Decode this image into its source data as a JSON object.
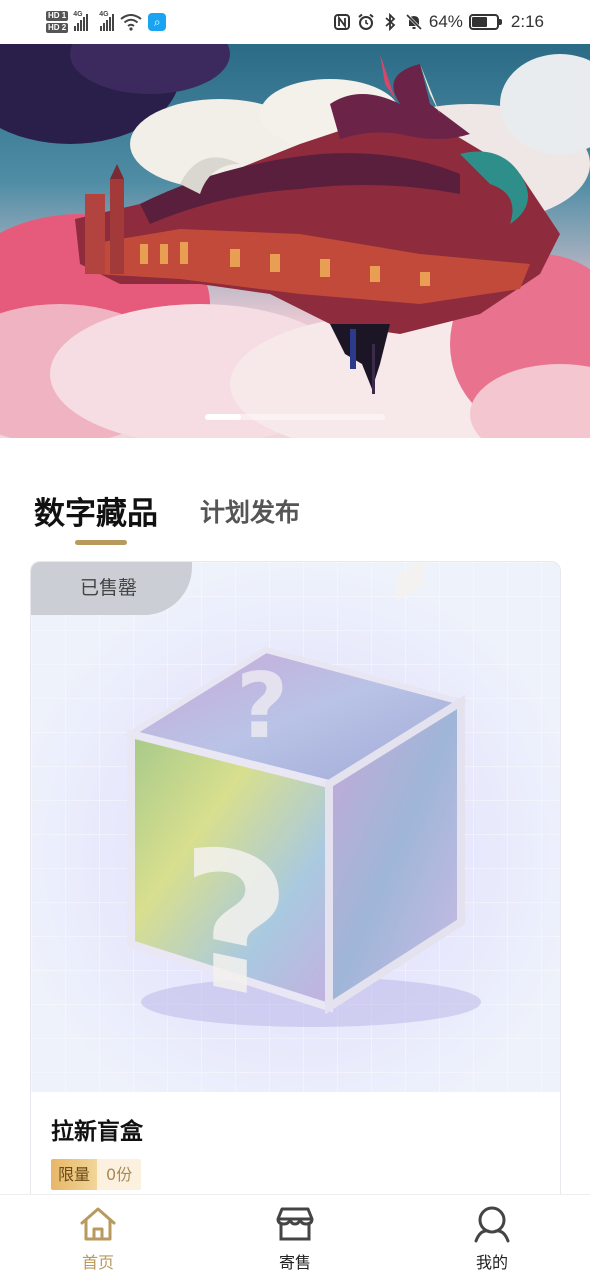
{
  "status_bar": {
    "sim1": "HD 1",
    "sim2": "HD 2",
    "net1": "4G",
    "net2": "4G",
    "battery_percent": "64%",
    "battery_level": 0.64,
    "time": "2:16"
  },
  "banner": {
    "slide_count": 5,
    "active_slide": 1
  },
  "tabs": [
    {
      "label": "数字藏品",
      "active": true
    },
    {
      "label": "计划发布",
      "active": false
    }
  ],
  "product": {
    "status_badge": "已售罄",
    "title": "拉新盲盒",
    "tag_label": "限量",
    "tag_value": "0份"
  },
  "bottom_nav": [
    {
      "label": "首页",
      "icon": "home-icon",
      "active": true
    },
    {
      "label": "寄售",
      "icon": "store-icon",
      "active": false
    },
    {
      "label": "我的",
      "icon": "user-icon",
      "active": false
    }
  ],
  "colors": {
    "accent": "#b89a5e",
    "badge": "#cbced4",
    "tag_gold": "#e7b768"
  }
}
